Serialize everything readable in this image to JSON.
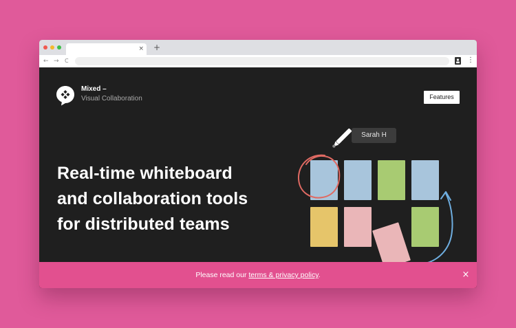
{
  "browser": {
    "window_controls": {
      "close_color": "#f05a50",
      "minimize_color": "#f4b92e",
      "maximize_color": "#3fbf4b"
    },
    "tab": {
      "close_glyph": "×"
    },
    "new_tab_glyph": "+",
    "nav": {
      "back_glyph": "←",
      "forward_glyph": "→",
      "reload_glyph": "C"
    },
    "menu_glyph": "⋮"
  },
  "header": {
    "brand_name": "Mixed –",
    "brand_tagline": "Visual Collaboration",
    "features_label": "Features"
  },
  "hero": {
    "line1": "Real-time whiteboard",
    "line2": "and collaboration tools",
    "line3": "for distributed teams"
  },
  "illustration": {
    "cursor_label": "Sarah H",
    "note_colors": {
      "blue": "#a8c5dc",
      "green": "#a8cb72",
      "yellow": "#e6c56a",
      "pink": "#eab6b8"
    },
    "circle_color": "#e06a63",
    "arrow_color": "#6faee0"
  },
  "banner": {
    "text_before": "Please read our ",
    "link_label": "terms & privacy policy",
    "text_after": ".",
    "close_glyph": "×"
  },
  "colors": {
    "background": "#e05a9a",
    "page_bg": "#1f1f1f",
    "banner_bg": "#e2508f"
  }
}
